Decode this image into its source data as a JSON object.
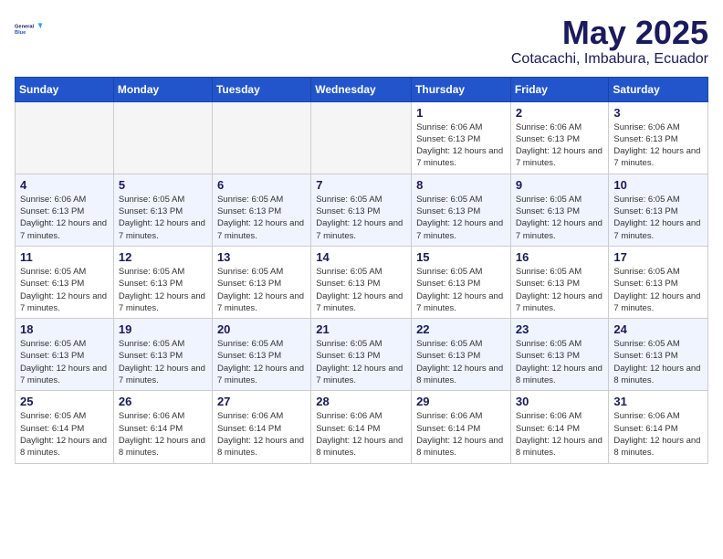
{
  "header": {
    "logo_line1": "General",
    "logo_line2": "Blue",
    "title": "May 2025",
    "subtitle": "Cotacachi, Imbabura, Ecuador"
  },
  "weekdays": [
    "Sunday",
    "Monday",
    "Tuesday",
    "Wednesday",
    "Thursday",
    "Friday",
    "Saturday"
  ],
  "weeks": [
    [
      {
        "day": "",
        "empty": true
      },
      {
        "day": "",
        "empty": true
      },
      {
        "day": "",
        "empty": true
      },
      {
        "day": "",
        "empty": true
      },
      {
        "day": "1",
        "sunrise": "6:06 AM",
        "sunset": "6:13 PM",
        "daylight": "Daylight: 12 hours and 7 minutes."
      },
      {
        "day": "2",
        "sunrise": "6:06 AM",
        "sunset": "6:13 PM",
        "daylight": "Daylight: 12 hours and 7 minutes."
      },
      {
        "day": "3",
        "sunrise": "6:06 AM",
        "sunset": "6:13 PM",
        "daylight": "Daylight: 12 hours and 7 minutes."
      }
    ],
    [
      {
        "day": "4",
        "sunrise": "6:06 AM",
        "sunset": "6:13 PM",
        "daylight": "Daylight: 12 hours and 7 minutes."
      },
      {
        "day": "5",
        "sunrise": "6:05 AM",
        "sunset": "6:13 PM",
        "daylight": "Daylight: 12 hours and 7 minutes."
      },
      {
        "day": "6",
        "sunrise": "6:05 AM",
        "sunset": "6:13 PM",
        "daylight": "Daylight: 12 hours and 7 minutes."
      },
      {
        "day": "7",
        "sunrise": "6:05 AM",
        "sunset": "6:13 PM",
        "daylight": "Daylight: 12 hours and 7 minutes."
      },
      {
        "day": "8",
        "sunrise": "6:05 AM",
        "sunset": "6:13 PM",
        "daylight": "Daylight: 12 hours and 7 minutes."
      },
      {
        "day": "9",
        "sunrise": "6:05 AM",
        "sunset": "6:13 PM",
        "daylight": "Daylight: 12 hours and 7 minutes."
      },
      {
        "day": "10",
        "sunrise": "6:05 AM",
        "sunset": "6:13 PM",
        "daylight": "Daylight: 12 hours and 7 minutes."
      }
    ],
    [
      {
        "day": "11",
        "sunrise": "6:05 AM",
        "sunset": "6:13 PM",
        "daylight": "Daylight: 12 hours and 7 minutes."
      },
      {
        "day": "12",
        "sunrise": "6:05 AM",
        "sunset": "6:13 PM",
        "daylight": "Daylight: 12 hours and 7 minutes."
      },
      {
        "day": "13",
        "sunrise": "6:05 AM",
        "sunset": "6:13 PM",
        "daylight": "Daylight: 12 hours and 7 minutes."
      },
      {
        "day": "14",
        "sunrise": "6:05 AM",
        "sunset": "6:13 PM",
        "daylight": "Daylight: 12 hours and 7 minutes."
      },
      {
        "day": "15",
        "sunrise": "6:05 AM",
        "sunset": "6:13 PM",
        "daylight": "Daylight: 12 hours and 7 minutes."
      },
      {
        "day": "16",
        "sunrise": "6:05 AM",
        "sunset": "6:13 PM",
        "daylight": "Daylight: 12 hours and 7 minutes."
      },
      {
        "day": "17",
        "sunrise": "6:05 AM",
        "sunset": "6:13 PM",
        "daylight": "Daylight: 12 hours and 7 minutes."
      }
    ],
    [
      {
        "day": "18",
        "sunrise": "6:05 AM",
        "sunset": "6:13 PM",
        "daylight": "Daylight: 12 hours and 7 minutes."
      },
      {
        "day": "19",
        "sunrise": "6:05 AM",
        "sunset": "6:13 PM",
        "daylight": "Daylight: 12 hours and 7 minutes."
      },
      {
        "day": "20",
        "sunrise": "6:05 AM",
        "sunset": "6:13 PM",
        "daylight": "Daylight: 12 hours and 7 minutes."
      },
      {
        "day": "21",
        "sunrise": "6:05 AM",
        "sunset": "6:13 PM",
        "daylight": "Daylight: 12 hours and 7 minutes."
      },
      {
        "day": "22",
        "sunrise": "6:05 AM",
        "sunset": "6:13 PM",
        "daylight": "Daylight: 12 hours and 8 minutes."
      },
      {
        "day": "23",
        "sunrise": "6:05 AM",
        "sunset": "6:13 PM",
        "daylight": "Daylight: 12 hours and 8 minutes."
      },
      {
        "day": "24",
        "sunrise": "6:05 AM",
        "sunset": "6:13 PM",
        "daylight": "Daylight: 12 hours and 8 minutes."
      }
    ],
    [
      {
        "day": "25",
        "sunrise": "6:05 AM",
        "sunset": "6:14 PM",
        "daylight": "Daylight: 12 hours and 8 minutes."
      },
      {
        "day": "26",
        "sunrise": "6:06 AM",
        "sunset": "6:14 PM",
        "daylight": "Daylight: 12 hours and 8 minutes."
      },
      {
        "day": "27",
        "sunrise": "6:06 AM",
        "sunset": "6:14 PM",
        "daylight": "Daylight: 12 hours and 8 minutes."
      },
      {
        "day": "28",
        "sunrise": "6:06 AM",
        "sunset": "6:14 PM",
        "daylight": "Daylight: 12 hours and 8 minutes."
      },
      {
        "day": "29",
        "sunrise": "6:06 AM",
        "sunset": "6:14 PM",
        "daylight": "Daylight: 12 hours and 8 minutes."
      },
      {
        "day": "30",
        "sunrise": "6:06 AM",
        "sunset": "6:14 PM",
        "daylight": "Daylight: 12 hours and 8 minutes."
      },
      {
        "day": "31",
        "sunrise": "6:06 AM",
        "sunset": "6:14 PM",
        "daylight": "Daylight: 12 hours and 8 minutes."
      }
    ]
  ]
}
